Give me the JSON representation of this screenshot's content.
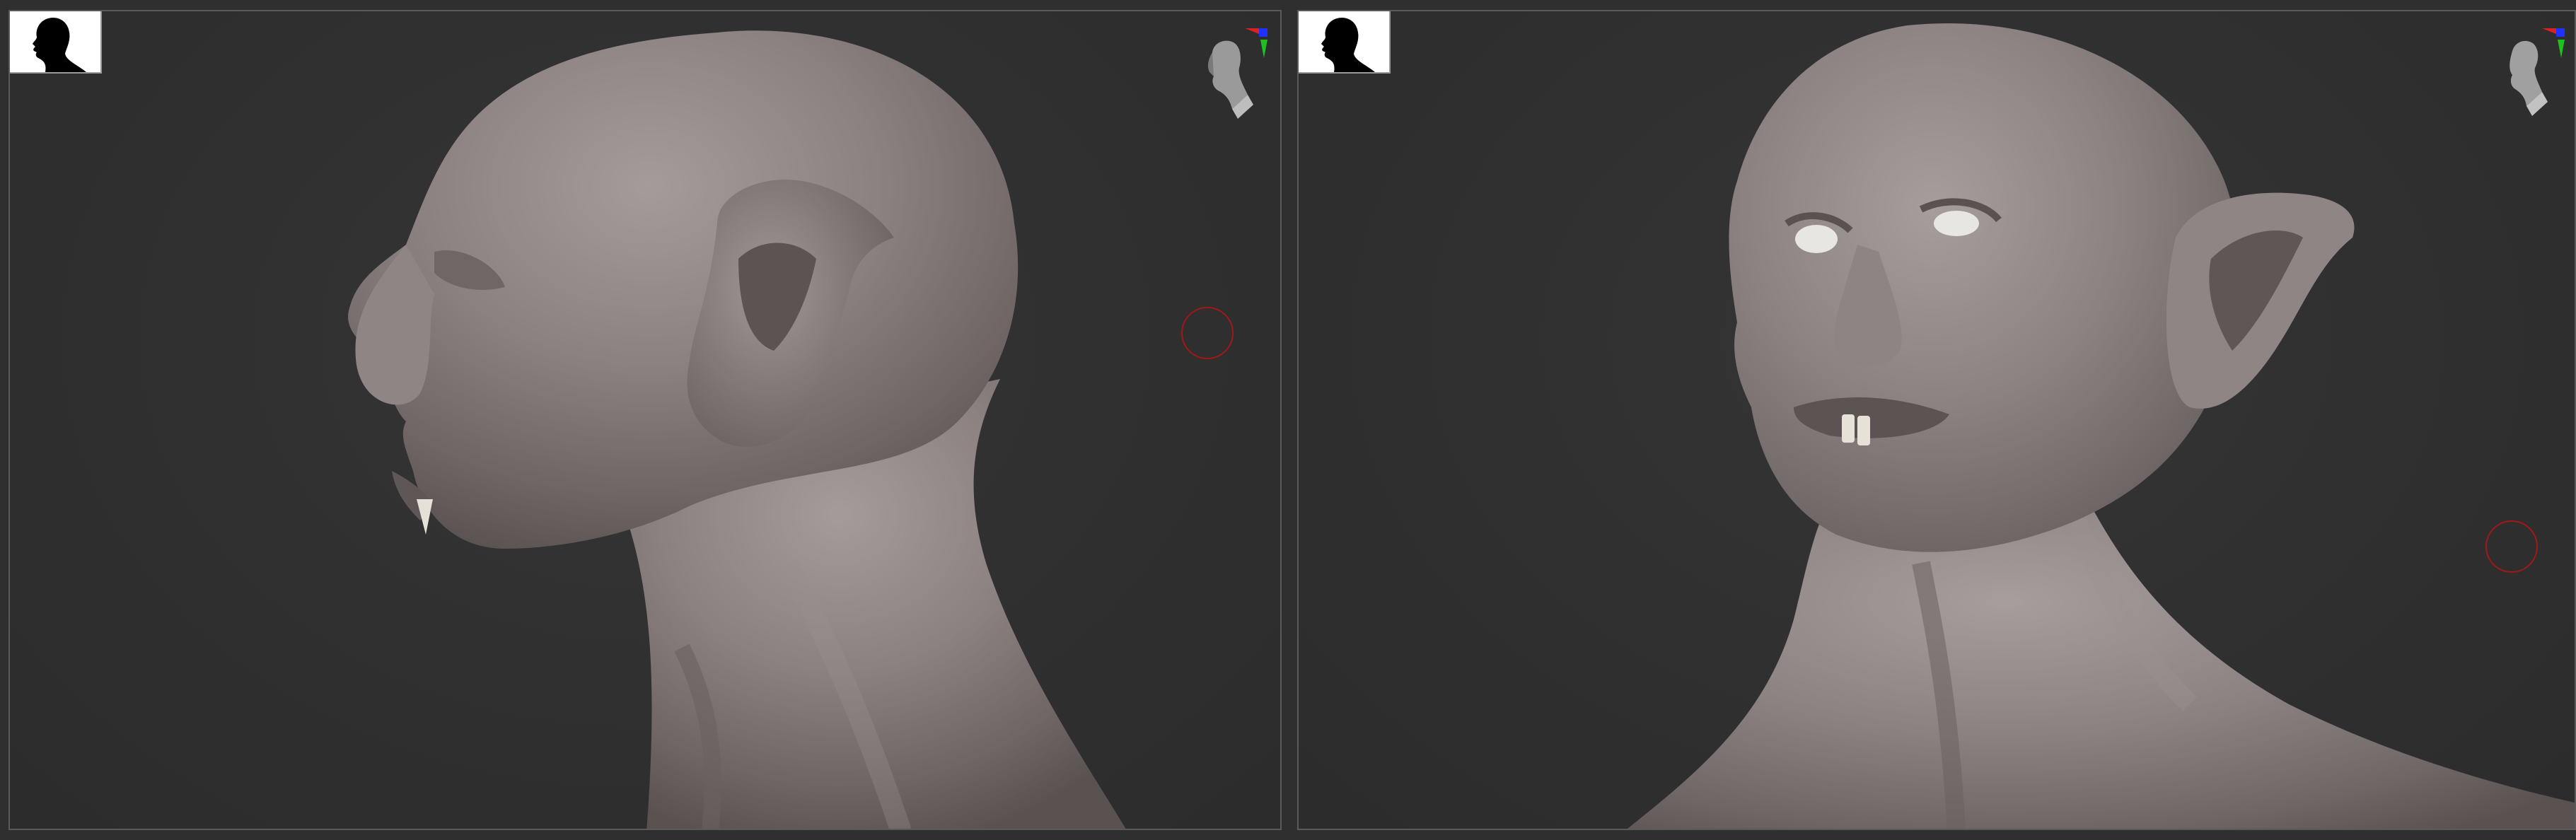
{
  "app": {
    "viewports": [
      {
        "id": "left",
        "view": "side profile",
        "has_silhouette_button": true,
        "has_perspective_gizmo": true,
        "has_brush_cursor": true
      },
      {
        "id": "right",
        "view": "three-quarter",
        "has_silhouette_button": true,
        "has_perspective_gizmo": true,
        "has_brush_cursor": true
      }
    ],
    "icons": {
      "silhouette": "head-silhouette-icon",
      "gizmo": "perspective-head-gizmo-icon",
      "brush": "brush-cursor-icon"
    },
    "colors": {
      "background": "#2f2f2f",
      "viewport_border": "#5a5a5a",
      "skin": "#8a7f7f",
      "brush_ring": "#a01818",
      "axis_x": "#e02020",
      "axis_y": "#20c020",
      "axis_z": "#2030ff"
    }
  }
}
